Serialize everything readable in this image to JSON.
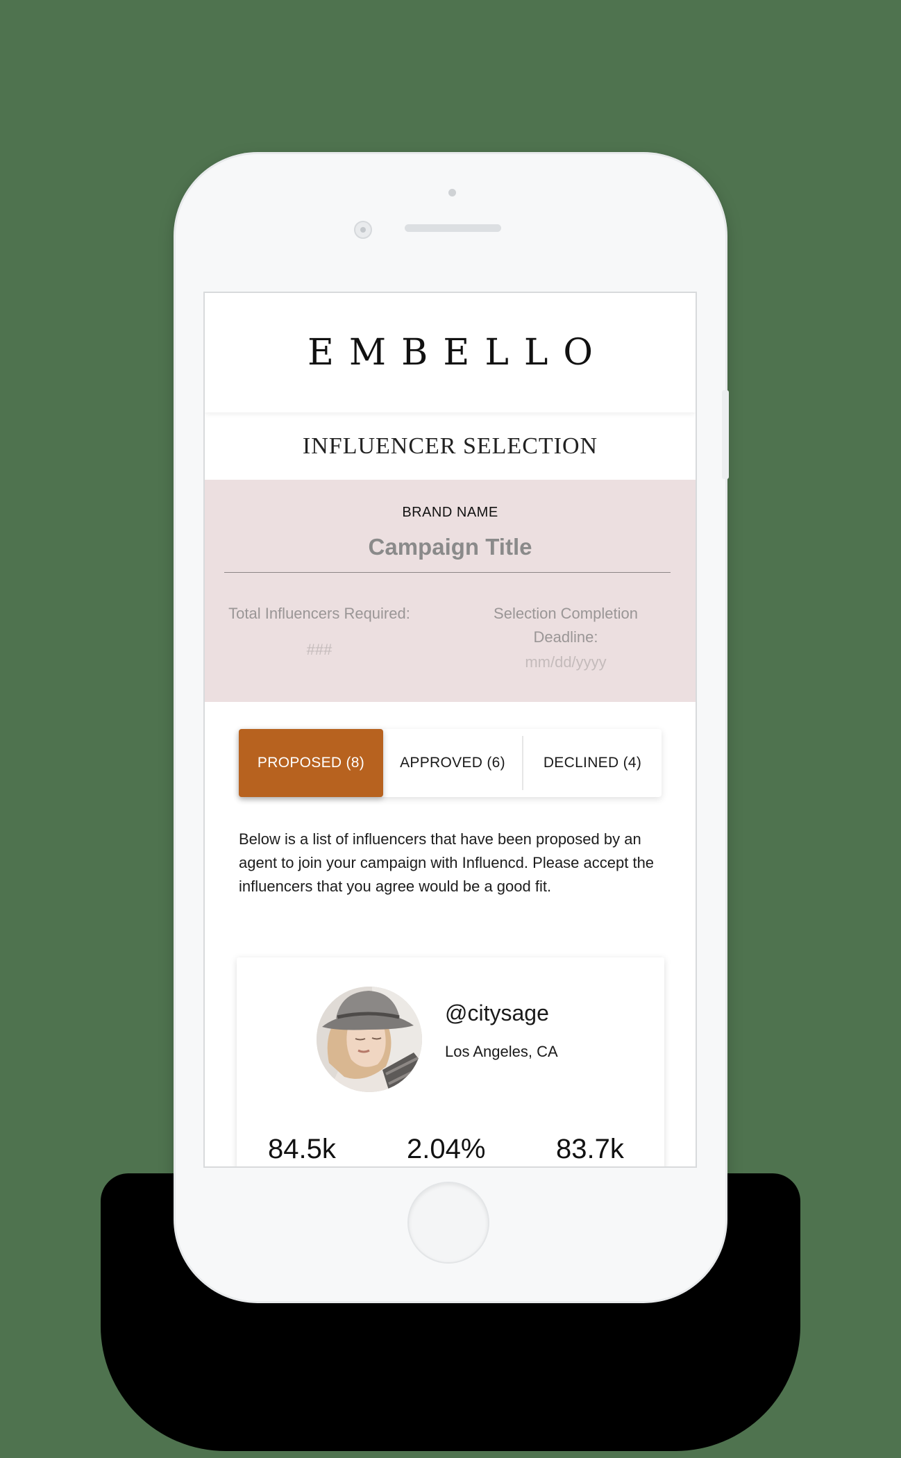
{
  "app": {
    "logo": "EMBELLO"
  },
  "page": {
    "title": "INFLUENCER SELECTION"
  },
  "campaign": {
    "brand_name": "BRAND NAME",
    "title": "Campaign Title",
    "influencers_label": "Total Influencers Required:",
    "influencers_value": "###",
    "deadline_label_line1": "Selection Completion",
    "deadline_label_line2": "Deadline:",
    "deadline_value": "mm/dd/yyyy"
  },
  "tabs": [
    {
      "label": "PROPOSED (8)",
      "active": true
    },
    {
      "label": "APPROVED (6)",
      "active": false
    },
    {
      "label": "DECLINED (4)",
      "active": false
    }
  ],
  "intro_text": "Below is a list of influencers that have been proposed by an agent to join your campaign with Influencd. Please accept the influencers that you agree would be a good fit.",
  "influencer": {
    "handle": "@citysage",
    "location": "Los Angeles, CA",
    "stats": [
      "84.5k",
      "2.04%",
      "83.7k"
    ]
  },
  "colors": {
    "accent": "#b7621f",
    "campaign_bg": "#ecdfe0",
    "backdrop": "#4f734f"
  }
}
